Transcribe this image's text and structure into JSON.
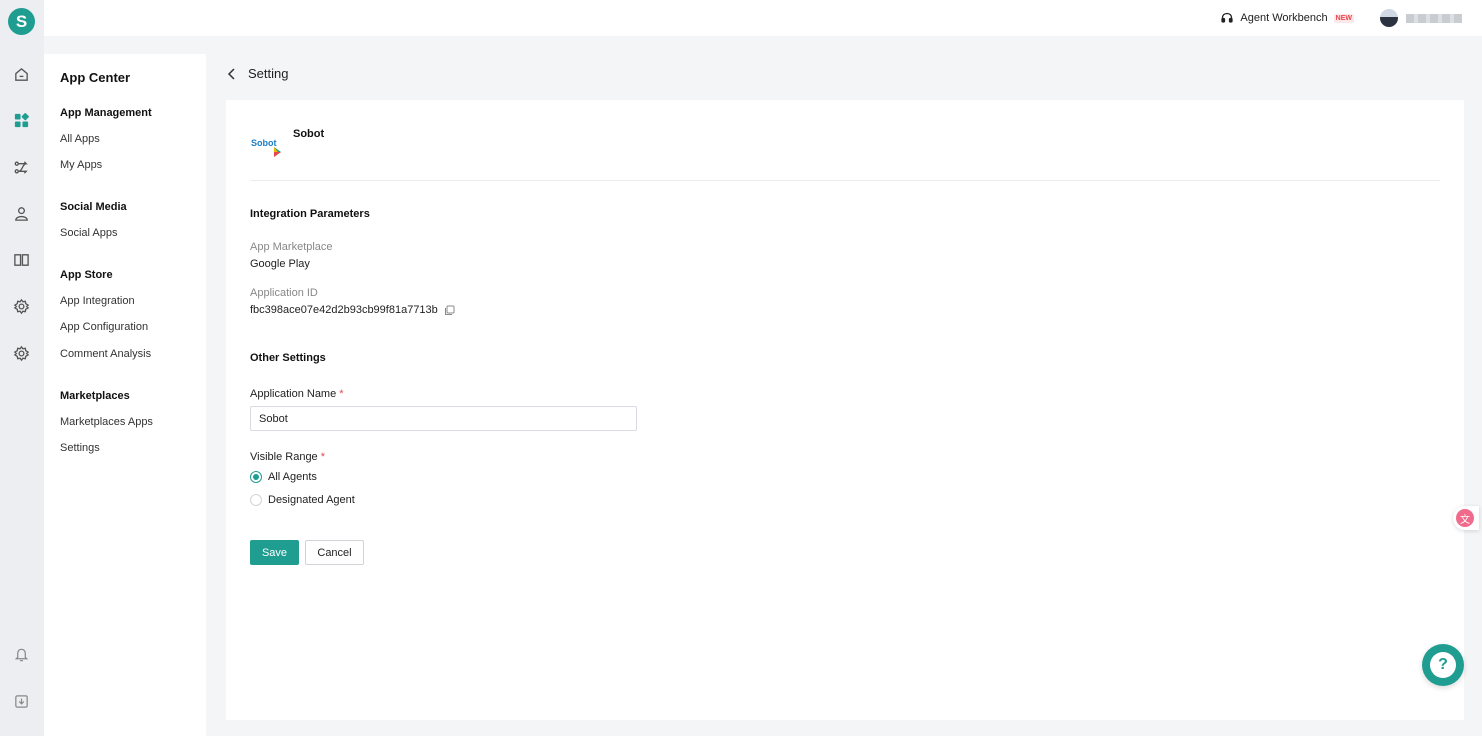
{
  "brand": {
    "logo_letter": "S",
    "color": "#1f9d91"
  },
  "rail": {
    "icons": [
      "home-icon",
      "apps-icon",
      "routing-icon",
      "customer-icon",
      "knowledge-book-icon",
      "settings-icon",
      "system-settings-icon",
      "notification-bell-icon",
      "download-icon"
    ]
  },
  "topbar": {
    "workbench_label": "Agent Workbench",
    "new_badge": "NEW"
  },
  "sidebar": {
    "title": "App Center",
    "groups": [
      {
        "label": "App Management",
        "items": [
          "All Apps",
          "My Apps"
        ]
      },
      {
        "label": "Social Media",
        "items": [
          "Social Apps"
        ]
      },
      {
        "label": "App Store",
        "items": [
          "App Integration",
          "App Configuration",
          "Comment Analysis"
        ]
      },
      {
        "label": "Marketplaces",
        "items": [
          "Marketplaces Apps",
          "Settings"
        ]
      }
    ]
  },
  "page": {
    "title": "Setting",
    "app_name": "Sobot",
    "app_logo_text": "Sobot",
    "integration": {
      "title": "Integration Parameters",
      "marketplace_label": "App Marketplace",
      "marketplace_value": "Google Play",
      "app_id_label": "Application ID",
      "app_id_value": "fbc398ace07e42d2b93cb99f81a7713b"
    },
    "other": {
      "title": "Other Settings",
      "app_name_label": "Application Name",
      "app_name_value": "Sobot",
      "visible_range_label": "Visible Range",
      "required_mark": "*",
      "options": [
        {
          "label": "All Agents",
          "selected": true
        },
        {
          "label": "Designated Agent",
          "selected": false
        }
      ]
    },
    "save_label": "Save",
    "cancel_label": "Cancel"
  },
  "help_label": "?",
  "translate_label": "文"
}
